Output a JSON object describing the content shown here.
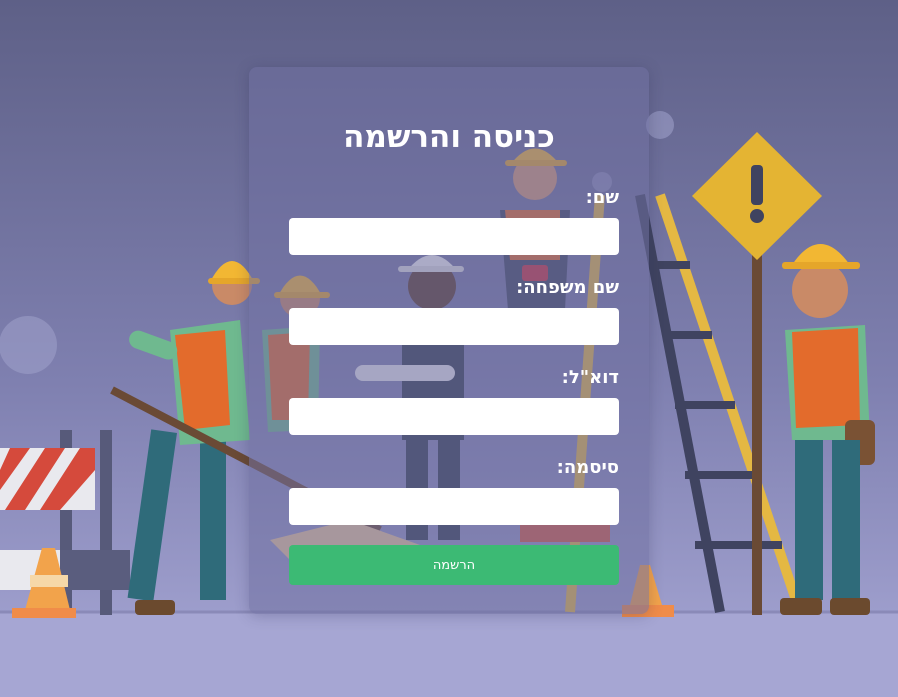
{
  "form": {
    "title": "כניסה והרשמה",
    "fields": [
      {
        "label": "שם:",
        "value": "",
        "placeholder": ""
      },
      {
        "label": "שם משפחה:",
        "value": "",
        "placeholder": ""
      },
      {
        "label": "דוא\"ל:",
        "value": "",
        "placeholder": ""
      },
      {
        "label": "סיסמה:",
        "value": "",
        "placeholder": ""
      }
    ],
    "submit_label": "הרשמה"
  },
  "colors": {
    "card_bg": "#7070a0",
    "button": "#3cba74",
    "sky_top": "#5f6288",
    "sky_bottom": "#a7a7d4"
  }
}
